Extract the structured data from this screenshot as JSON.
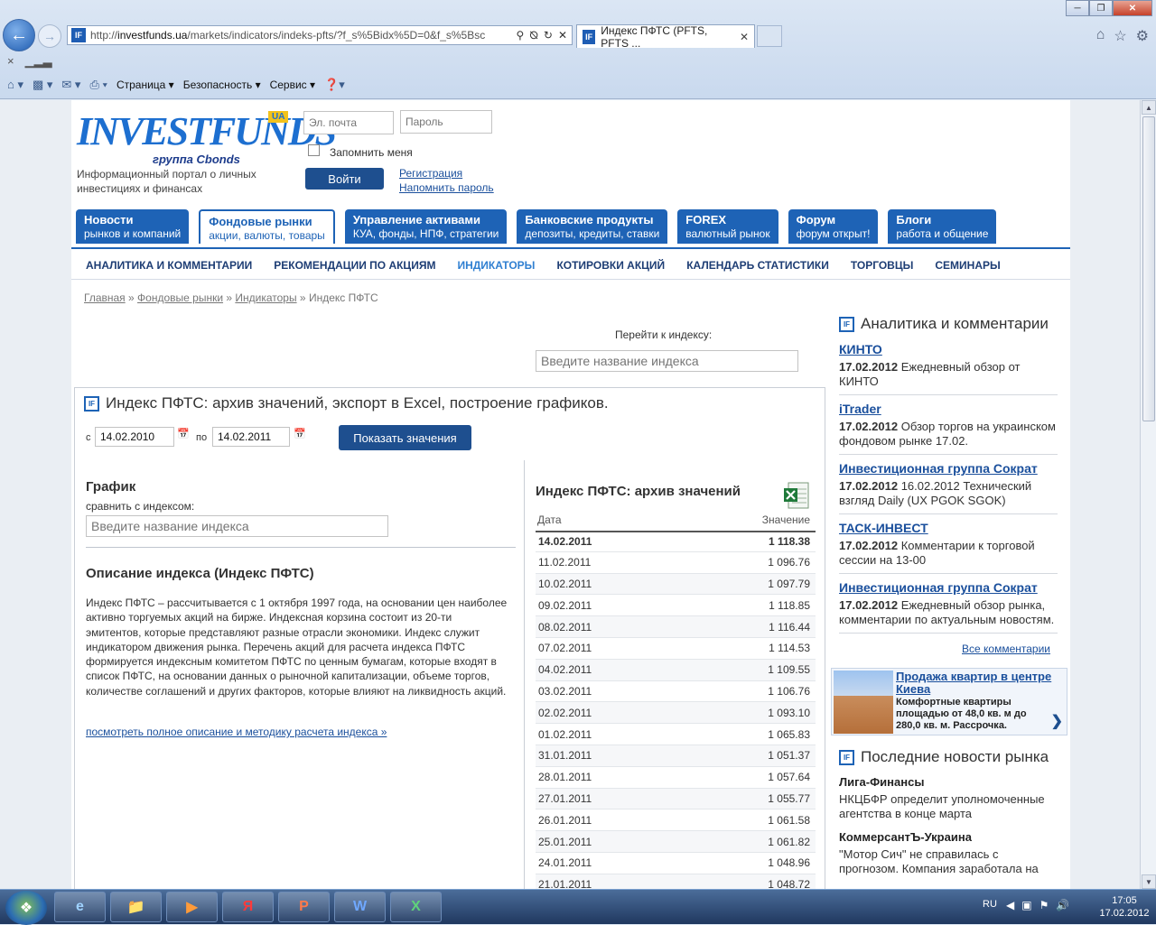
{
  "browser": {
    "url_prefix": "http://",
    "url_domain": "investfunds.ua",
    "url_rest": "/markets/indicators/indeks-pfts/?f_s%5Bidx%5D=0&f_s%5Bsc",
    "favicon": "IF",
    "tab_title": "Индекс ПФТС (PFTS, PFTS ...",
    "cmd": {
      "page": "Страница",
      "security": "Безопасность",
      "service": "Сервис"
    }
  },
  "site": {
    "logo_word": "INVESTFUNDS",
    "logo_sub": "группа Cbonds",
    "logo_ua": "UA",
    "tagline": "Информационный портал о личных инвестициях и финансах",
    "login": {
      "email_placeholder": "Эл. почта",
      "password_placeholder": "Пароль",
      "remember": "Запомнить меня",
      "submit": "Войти",
      "register": "Регистрация",
      "remind": "Напомнить пароль"
    },
    "nav": [
      {
        "title": "Новости",
        "sub": "рынков и компаний"
      },
      {
        "title": "Фондовые рынки",
        "sub": "акции, валюты, товары"
      },
      {
        "title": "Управление активами",
        "sub": "КУА, фонды, НПФ, стратегии"
      },
      {
        "title": "Банковские продукты",
        "sub": "депозиты, кредиты, ставки"
      },
      {
        "title": "FOREX",
        "sub": "валютный рынок"
      },
      {
        "title": "Форум",
        "sub": "форум открыт!"
      },
      {
        "title": "Блоги",
        "sub": "работа и общение"
      }
    ],
    "subnav": [
      "АНАЛИТИКА И КОММЕНТАРИИ",
      "РЕКОМЕНДАЦИИ ПО АКЦИЯМ",
      "ИНДИКАТОРЫ",
      "КОТИРОВКИ АКЦИЙ",
      "КАЛЕНДАРЬ СТАТИСТИКИ",
      "ТОРГОВЦЫ",
      "СЕМИНАРЫ"
    ],
    "breadcrumbs": [
      "Главная",
      "Фондовые рынки",
      "Индикаторы",
      "Индекс ПФТС"
    ],
    "breadcrumb_sep": " » ",
    "goto_label": "Перейти к индексу:",
    "goto_placeholder": "Введите название индекса"
  },
  "main": {
    "icon": "IF",
    "title": "Индекс ПФТС: архив значений, экспорт в Excel, построение графиков.",
    "from_label": "с",
    "from_date": "14.02.2010",
    "to_label": "по",
    "to_date": "14.02.2011",
    "show_button": "Показать значения",
    "chart_title": "График",
    "compare_label": "сравнить с индексом:",
    "compare_placeholder": "Введите название индекса",
    "desc_title": "Описание индекса (Индекс ПФТС)",
    "desc_text": "Индекс ПФТС – рассчитывается с 1 октября 1997 года, на основании цен наиболее активно торгуемых акций на бирже. Индексная корзина состоит из 20-ти эмитентов, которые представляют разные отрасли экономики. Индекс служит индикатором движения рынка. Перечень акций для расчета индекса ПФТС формируется индексным комитетом ПФТС по ценным бумагам, которые входят в список ПФТС, на основании данных о рыночной капитализации, объеме торгов, количестве соглашений и других факторов, которые влияют на ликвидность акций.",
    "desc_link": "посмотреть полное описание и методику расчета индекса »",
    "archive_title": "Индекс ПФТС: архив значений",
    "col_date": "Дата",
    "col_value": "Значение",
    "rows": [
      {
        "date": "14.02.2011",
        "value": "1 118.38"
      },
      {
        "date": "11.02.2011",
        "value": "1 096.76"
      },
      {
        "date": "10.02.2011",
        "value": "1 097.79"
      },
      {
        "date": "09.02.2011",
        "value": "1 118.85"
      },
      {
        "date": "08.02.2011",
        "value": "1 116.44"
      },
      {
        "date": "07.02.2011",
        "value": "1 114.53"
      },
      {
        "date": "04.02.2011",
        "value": "1 109.55"
      },
      {
        "date": "03.02.2011",
        "value": "1 106.76"
      },
      {
        "date": "02.02.2011",
        "value": "1 093.10"
      },
      {
        "date": "01.02.2011",
        "value": "1 065.83"
      },
      {
        "date": "31.01.2011",
        "value": "1 051.37"
      },
      {
        "date": "28.01.2011",
        "value": "1 057.64"
      },
      {
        "date": "27.01.2011",
        "value": "1 055.77"
      },
      {
        "date": "26.01.2011",
        "value": "1 061.58"
      },
      {
        "date": "25.01.2011",
        "value": "1 061.82"
      },
      {
        "date": "24.01.2011",
        "value": "1 048.96"
      },
      {
        "date": "21.01.2011",
        "value": "1 048.72"
      }
    ]
  },
  "sidebar": {
    "analytics_title": "Аналитика и комментарии",
    "analytics": [
      {
        "source": "КИНТО",
        "date": "17.02.2012",
        "text": "Ежедневный обзор от КИНТО"
      },
      {
        "source": "iTrader",
        "date": "17.02.2012",
        "text": "Обзор торгов на украинском фондовом рынке 17.02."
      },
      {
        "source": "Инвестиционная группа Сократ",
        "date": "17.02.2012",
        "text": "16.02.2012 Технический взгляд Daily (UX PGOK SGOK)"
      },
      {
        "source": "ТАСК-ИНВЕСТ",
        "date": "17.02.2012",
        "text": "Комментарии к торговой сессии на 13-00"
      },
      {
        "source": "Инвестиционная группа Сократ",
        "date": "17.02.2012",
        "text": "Ежедневный обзор рынка, комментарии по актуальным новостям."
      }
    ],
    "all_comments": "Все комментарии",
    "ad_title": "Продажа квартир в центре Киева",
    "ad_text": "Комфортные квартиры площадью от 48,0 кв. м до 280,0 кв. м. Рассрочка.",
    "news_title": "Последние новости рынка",
    "news": [
      {
        "source": "Лига-Финансы",
        "text": "НКЦБФР определит уполномоченные агентства в конце марта"
      },
      {
        "source": "КоммерсантЪ-Украина",
        "text": "\"Мотор Сич\" не справилась с прогнозом. Компания заработала на"
      }
    ]
  },
  "taskbar": {
    "lang": "RU",
    "time": "17:05",
    "date": "17.02.2012"
  }
}
